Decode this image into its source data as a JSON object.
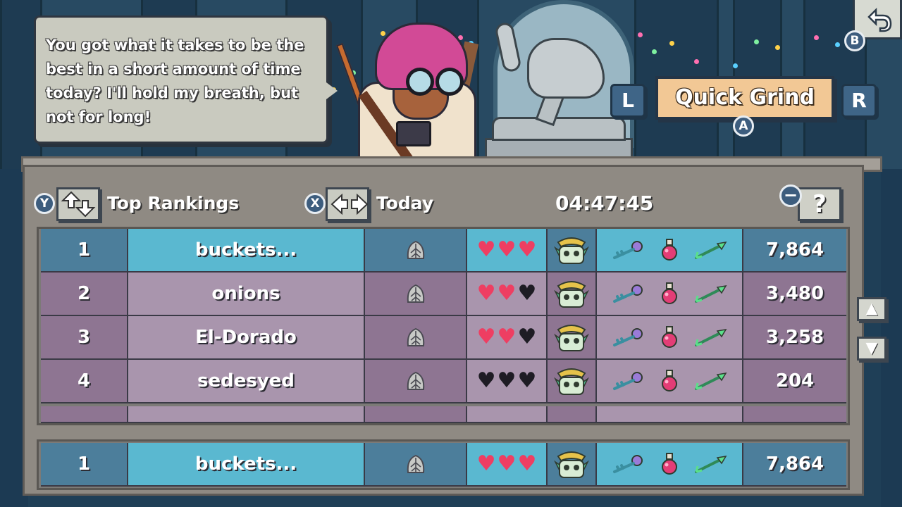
{
  "dialog": {
    "line1": "You got what it takes to be the",
    "line2": "best in a short amount of time",
    "line3": "today? I'll hold my breath, but",
    "line4": "not for long!"
  },
  "mode": {
    "title": "Quick Grind",
    "prev_button": "L",
    "next_button": "R",
    "confirm_button": "A",
    "back_button": "B"
  },
  "toolbar": {
    "ranking_button": "Y",
    "ranking_label": "Top Rankings",
    "period_button": "X",
    "period_label": "Today",
    "timer": "04:47:45",
    "help_button": "−",
    "help_label": "?"
  },
  "icons": {
    "class": "leaf-helmet-icon",
    "heart": "heart-icon",
    "trophy": "skull-trophy-icon",
    "key": "key-icon",
    "potion": "potion-icon",
    "arrow": "arrow-icon",
    "scroll_up": "arrow-up-icon",
    "scroll_down": "arrow-down-icon"
  },
  "colors": {
    "heart_full": "#ee3e62",
    "heart_empty": "#1e1c24",
    "highlight_row": "#5ab8d0",
    "normal_row": "#a995ad",
    "mode_banner": "#f2c895"
  },
  "leaderboard": [
    {
      "rank": "1",
      "name": "buckets...",
      "hearts": 3,
      "score": "7,864"
    },
    {
      "rank": "2",
      "name": "onions",
      "hearts": 2,
      "score": "3,480"
    },
    {
      "rank": "3",
      "name": "El-Dorado",
      "hearts": 2,
      "score": "3,258"
    },
    {
      "rank": "4",
      "name": "sedesyed",
      "hearts": 0,
      "score": "204"
    }
  ],
  "player": {
    "rank": "1",
    "name": "buckets...",
    "hearts": 3,
    "score": "7,864"
  },
  "hearts_max": 3,
  "scroll": {
    "up": "▲",
    "down": "▼"
  }
}
